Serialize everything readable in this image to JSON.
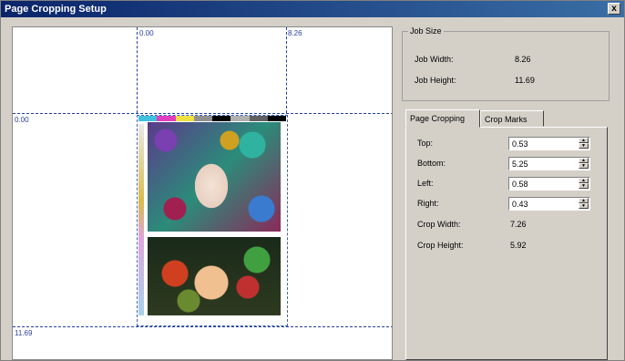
{
  "window": {
    "title": "Page Cropping Setup",
    "close_label": "x"
  },
  "preview": {
    "top_ruler": [
      "0.00",
      "8.26"
    ],
    "left_ruler": [
      "0.00",
      "11.69"
    ]
  },
  "job_size": {
    "legend": "Job Size",
    "width_label": "Job Width:",
    "width_value": "8.26",
    "height_label": "Job Height:",
    "height_value": "11.69"
  },
  "tabs": [
    {
      "label": "Page Cropping",
      "active": true
    },
    {
      "label": "Crop Marks",
      "active": false
    }
  ],
  "page_cropping": {
    "top_label": "Top:",
    "top_value": "0.53",
    "bottom_label": "Bottom:",
    "bottom_value": "5.25",
    "left_label": "Left:",
    "left_value": "0.58",
    "right_label": "Right:",
    "right_value": "0.43",
    "crop_width_label": "Crop Width:",
    "crop_width_value": "7.26",
    "crop_height_label": "Crop Height:",
    "crop_height_value": "5.92"
  },
  "colors": {
    "title_bar": "#0a246a",
    "guide": "#2040a0",
    "colorbar": [
      "#40c0e0",
      "#e040c0",
      "#f0e040",
      "#909090",
      "#000000",
      "#b0b0b0",
      "#606060",
      "#000000"
    ]
  }
}
